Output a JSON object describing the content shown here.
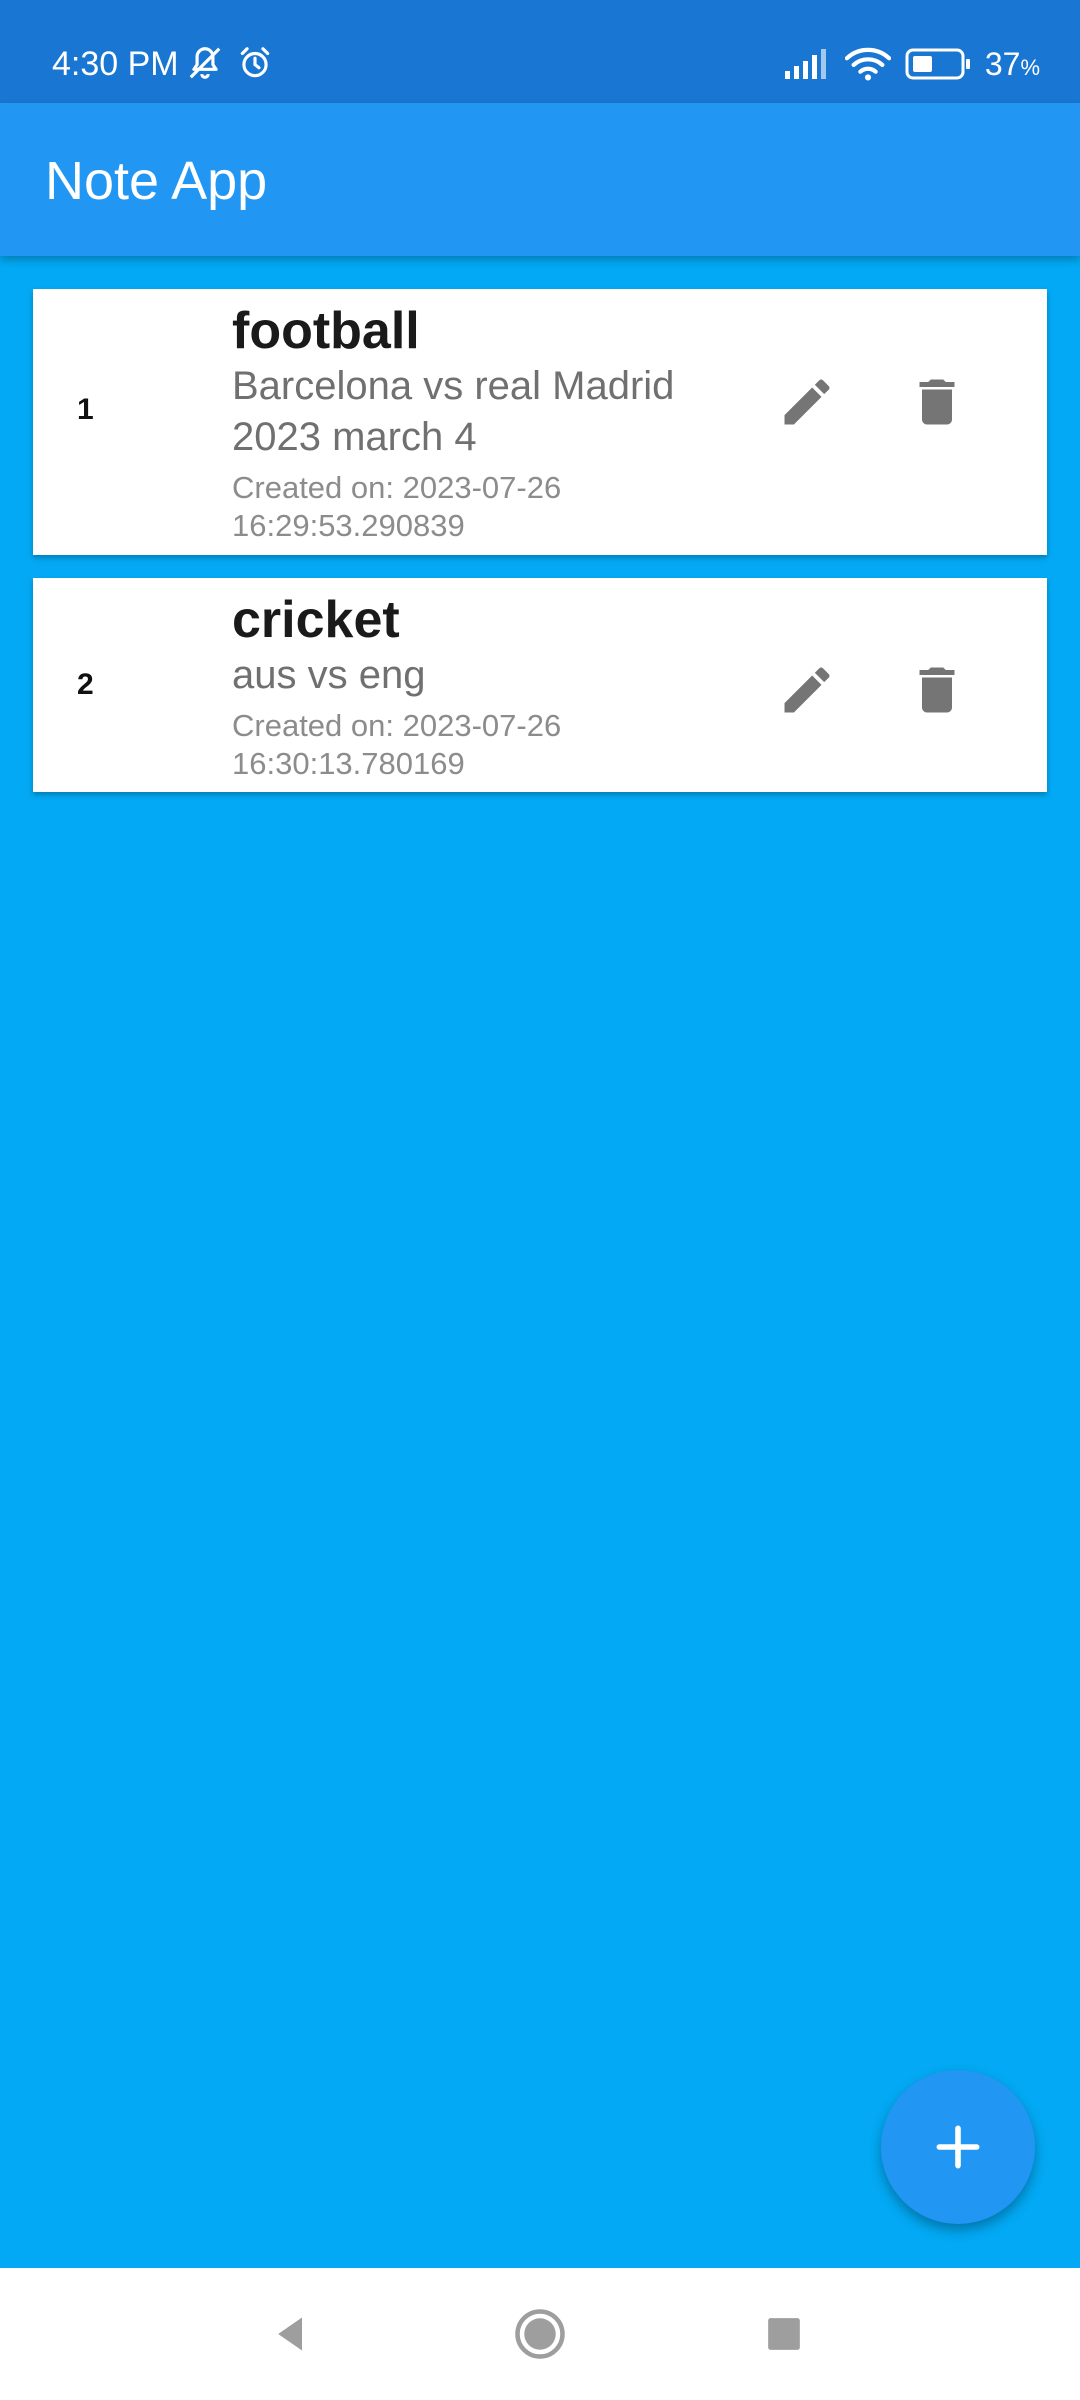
{
  "status_bar": {
    "time": "4:30 PM",
    "battery": "37",
    "battery_unit": "%",
    "icons": [
      "muted-bell-icon",
      "alarm-icon",
      "signal-icon",
      "wifi-icon",
      "battery-icon"
    ]
  },
  "app_bar": {
    "title": "Note App"
  },
  "notes": [
    {
      "index": "1",
      "title": "football",
      "description": "Barcelona vs real Madrid 2023 march 4",
      "created": "Created on: 2023-07-26 16:29:53.290839",
      "actions": [
        "pencil-icon",
        "trash-icon"
      ]
    },
    {
      "index": "2",
      "title": "cricket",
      "description": "aus vs eng",
      "created": "Created on: 2023-07-26 16:30:13.780169",
      "actions": [
        "pencil-icon",
        "trash-icon"
      ]
    }
  ],
  "fab": {
    "icon": "plus-icon"
  },
  "nav_bar": {
    "icons": [
      "back-icon",
      "home-icon",
      "recents-icon"
    ]
  },
  "colors": {
    "background": "#03A9F4",
    "app_bar": "#2196F3",
    "status_bar": "#1976D2",
    "card": "#FFFFFF",
    "icon_gray": "#757575"
  }
}
